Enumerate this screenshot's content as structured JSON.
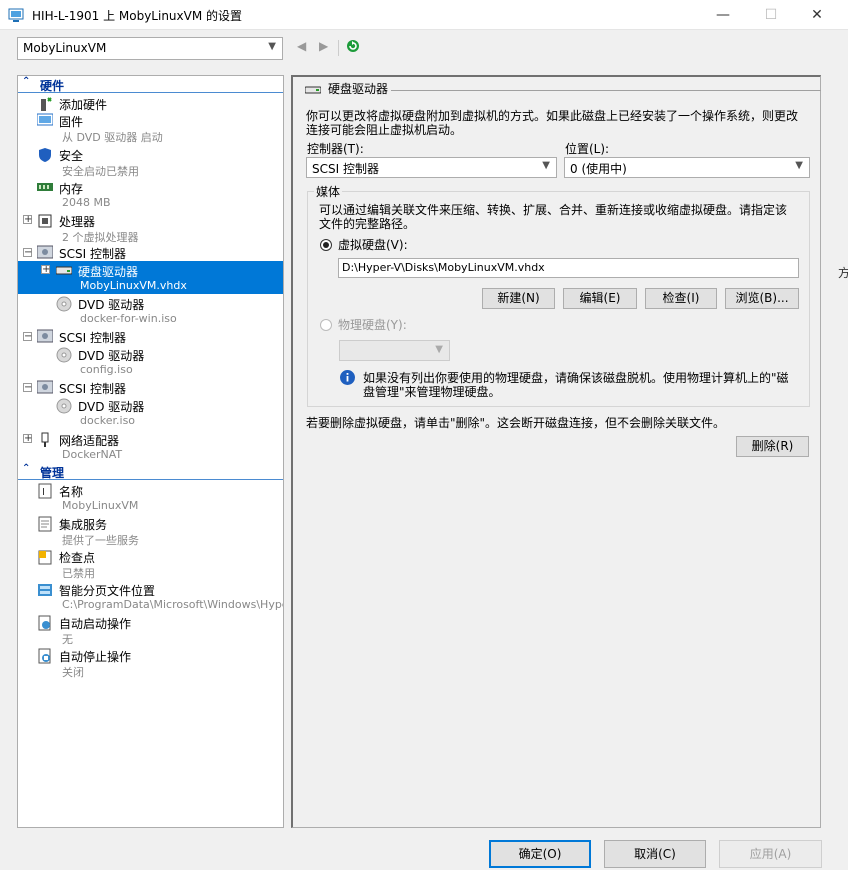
{
  "window": {
    "title": "HIH-L-1901 上 MobyLinuxVM 的设置",
    "minimize": "—",
    "maximize": "☐",
    "close": "✕"
  },
  "vm_select": {
    "value": "MobyLinuxVM"
  },
  "tree": {
    "hardware_header": "硬件",
    "management_header": "管理",
    "items": [
      {
        "label": "添加硬件",
        "sub": ""
      },
      {
        "label": "固件",
        "sub": "从 DVD 驱动器 启动"
      },
      {
        "label": "安全",
        "sub": "安全启动已禁用"
      },
      {
        "label": "内存",
        "sub": "2048 MB"
      },
      {
        "label": "处理器",
        "sub": "2 个虚拟处理器"
      },
      {
        "label": "SCSI 控制器",
        "sub": ""
      },
      {
        "label": "硬盘驱动器",
        "sub": "MobyLinuxVM.vhdx"
      },
      {
        "label": "DVD 驱动器",
        "sub": "docker-for-win.iso"
      },
      {
        "label": "SCSI 控制器",
        "sub": ""
      },
      {
        "label": "DVD 驱动器",
        "sub": "config.iso"
      },
      {
        "label": "SCSI 控制器",
        "sub": ""
      },
      {
        "label": "DVD 驱动器",
        "sub": "docker.iso"
      },
      {
        "label": "网络适配器",
        "sub": "DockerNAT"
      },
      {
        "label": "名称",
        "sub": "MobyLinuxVM"
      },
      {
        "label": "集成服务",
        "sub": "提供了一些服务"
      },
      {
        "label": "检查点",
        "sub": "已禁用"
      },
      {
        "label": "智能分页文件位置",
        "sub": "C:\\ProgramData\\Microsoft\\Windows\\Hyper-V"
      },
      {
        "label": "自动启动操作",
        "sub": "无"
      },
      {
        "label": "自动停止操作",
        "sub": "关闭"
      }
    ]
  },
  "panel": {
    "title": "硬盘驱动器",
    "desc1": "你可以更改将虚拟硬盘附加到虚拟机的方式。如果此磁盘上已经安装了一个操作系统，则更改",
    "desc2": "连接可能会阻止虚拟机启动。",
    "controller_label": "控制器(T):",
    "controller_value": "SCSI 控制器",
    "location_label": "位置(L):",
    "location_value": "0 (使用中)",
    "media_label": "媒体",
    "media_desc1": "可以通过编辑关联文件来压缩、转换、扩展、合并、重新连接或收缩虚拟硬盘。请指定该",
    "media_desc2": "文件的完整路径。",
    "vhd_radio": "虚拟硬盘(V):",
    "vhd_path": "D:\\Hyper-V\\Disks\\MobyLinuxVM.vhdx",
    "btn_new": "新建(N)",
    "btn_edit": "编辑(E)",
    "btn_inspect": "检查(I)",
    "btn_browse": "浏览(B)...",
    "phys_radio": "物理硬盘(Y):",
    "info1": "如果没有列出你要使用的物理硬盘，请确保该磁盘脱机。使用物理计算机上的\"磁",
    "info2": "盘管理\"来管理物理硬盘。",
    "remove_desc": "若要删除虚拟硬盘，请单击\"删除\"。这会断开磁盘连接，但不会删除关联文件。",
    "btn_remove": "删除(R)"
  },
  "footer": {
    "ok": "确定(O)",
    "cancel": "取消(C)",
    "apply": "应用(A)"
  },
  "edge_char": "方"
}
